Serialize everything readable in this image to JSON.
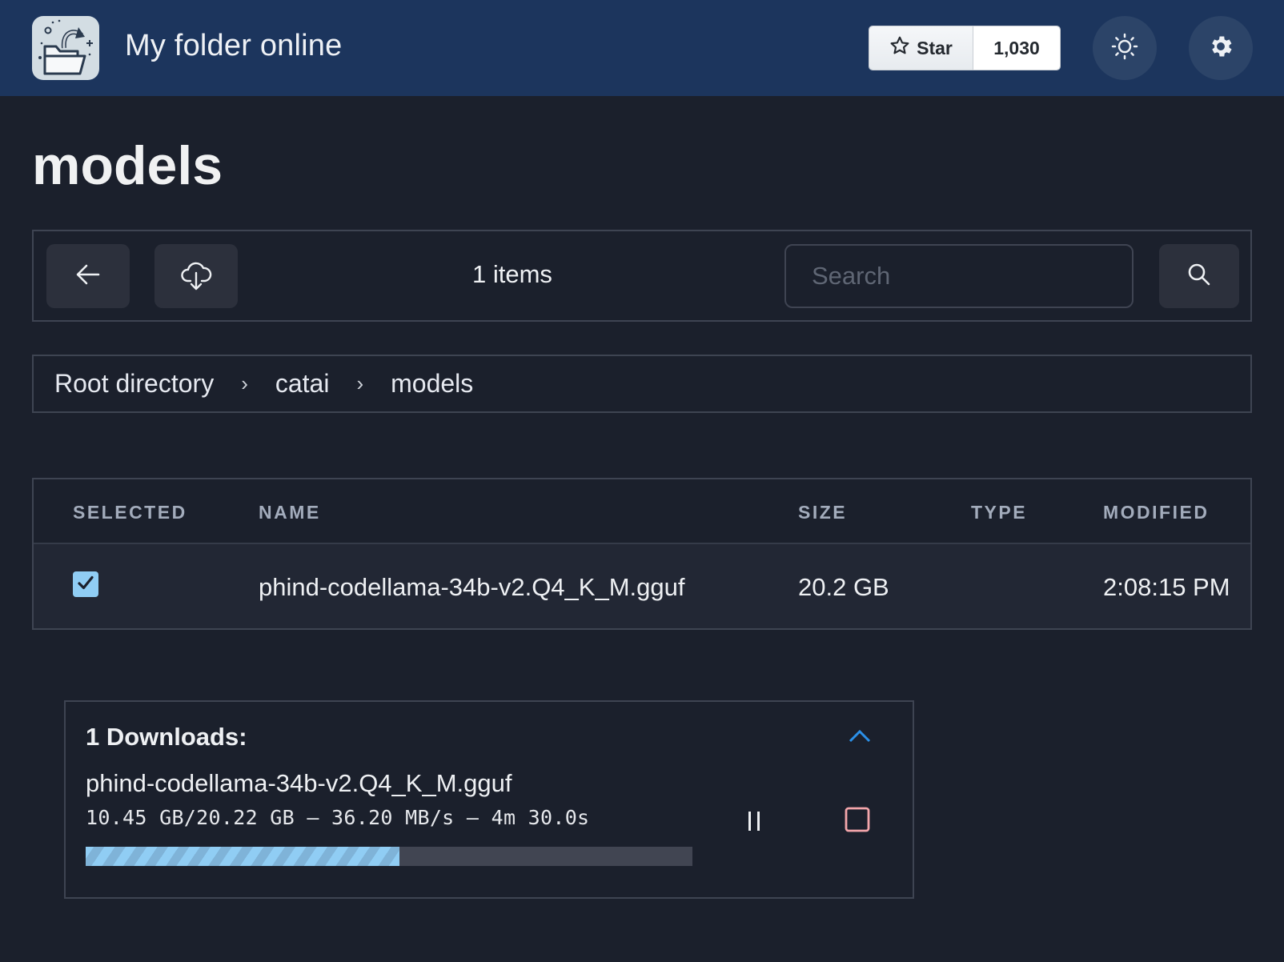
{
  "header": {
    "app_title": "My folder online",
    "logo_icon": "folder-open-icon",
    "star_label": "Star",
    "star_count": "1,030",
    "theme_toggle_icon": "sun-icon",
    "settings_icon": "gear-icon"
  },
  "page": {
    "title": "models"
  },
  "toolbar": {
    "back_icon": "arrow-left-icon",
    "download_icon": "cloud-download-icon",
    "items_count": "1 items",
    "search": {
      "placeholder": "Search",
      "value": ""
    },
    "search_icon": "search-icon"
  },
  "breadcrumb": {
    "items": [
      {
        "label": "Root directory"
      },
      {
        "label": "catai"
      },
      {
        "label": "models"
      }
    ],
    "separator": "›"
  },
  "table": {
    "columns": [
      "SELECTED",
      "NAME",
      "SIZE",
      "TYPE",
      "MODIFIED"
    ],
    "rows": [
      {
        "selected": true,
        "name": "phind-codellama-34b-v2.Q4_K_M.gguf",
        "size": "20.2 GB",
        "type": "",
        "modified": "2:08:15 PM"
      }
    ]
  },
  "downloads": {
    "title": "1 Downloads:",
    "items": [
      {
        "name": "phind-codellama-34b-v2.Q4_K_M.gguf",
        "stats": "10.45 GB/20.22 GB – 36.20 MB/s – 4m 30.0s",
        "progress": 0.517
      }
    ]
  },
  "colors": {
    "header_bg": "#1c355d",
    "page_bg": "#1b202c",
    "accent": "#90cdf4",
    "collapse_accent": "#2b90e8",
    "cancel_accent": "#f4a6ab"
  }
}
